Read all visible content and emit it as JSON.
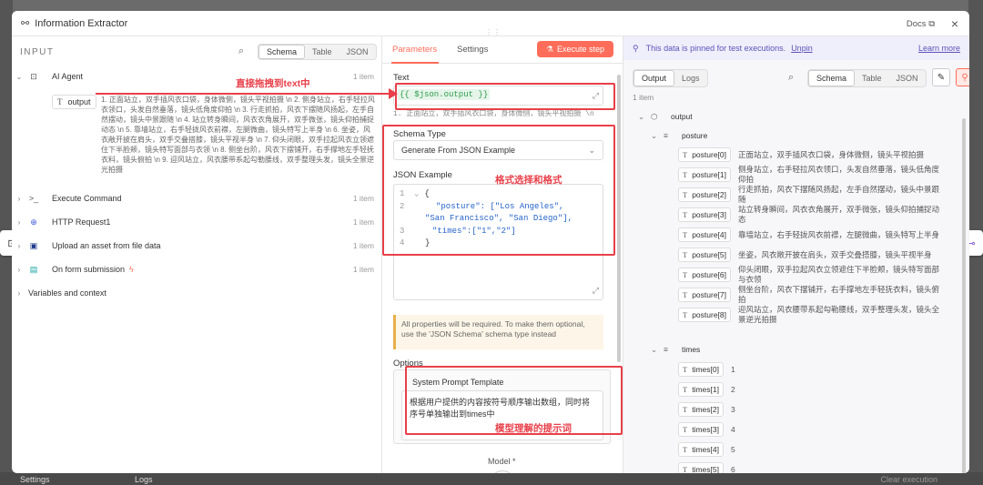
{
  "window": {
    "title": "Information Extractor",
    "docs_label": "Docs",
    "close_glyph": "×"
  },
  "background": {
    "settings_label": "Settings",
    "logs_label": "Logs",
    "last_exec_label": "Clear execution"
  },
  "input_panel": {
    "heading": "INPUT",
    "view_tabs": [
      "Schema",
      "Table",
      "JSON"
    ],
    "nodes": [
      {
        "name": "AI Agent",
        "count": "1 item",
        "icon": "robot-icon"
      },
      {
        "name": "Execute Command",
        "count": "1 item",
        "icon": "terminal-icon"
      },
      {
        "name": "HTTP Request1",
        "count": "1 item",
        "icon": "globe-icon"
      },
      {
        "name": "Upload an asset from file data",
        "count": "1 item",
        "icon": "image-icon"
      },
      {
        "name": "On form submission",
        "count": "1 item",
        "icon": "form-icon"
      }
    ],
    "variables_label": "Variables and context",
    "output_field_label": "output",
    "output_text": "1. 正面站立，双手插风衣口袋，身体微侧，镜头平视拍摄 \\n 2. 侧身站立，右手轻拉风衣领口，头发自然垂落，镜头低角度仰拍 \\n 3. 行走抓拍，风衣下摆随风扬起，左手自然摆动，镜头中景跟随 \\n 4. 站立转身瞬间，风衣衣角展开，双手微张，镜头仰拍捕捉动态 \\n 5. 靠墙站立，右手轻拢风衣前襟，左腿微曲，镜头特写上半身 \\n 6. 坐姿，风衣敞开披在肩头，双手交叠搭膝，镜头平视半身 \\n 7. 仰头闭眼，双手拉起风衣立领遮住下半脸颊，镜头特写面部与衣领 \\n 8. 侧坐台阶，风衣下摆铺开，右手撑地左手轻抚衣料，镜头俯拍 \\n 9. 迎风站立，风衣腰带系起勾勒腰线，双手整理头发，镜头全景逆光拍摄"
  },
  "annotations": {
    "drag_hint": "直接拖拽到text中",
    "format_hint": "格式选择和格式",
    "prompt_hint": "模型理解的提示词"
  },
  "params_panel": {
    "tabs": [
      "Parameters",
      "Settings"
    ],
    "execute_label": "Execute step",
    "text_label": "Text",
    "text_expression": "{{ $json.output }}",
    "text_preview": "1. 正面站立，双手插风衣口袋，身体微侧，镜头平视拍摄 \\n",
    "schema_type_label": "Schema Type",
    "schema_type_value": "Generate From JSON Example",
    "json_example_label": "JSON Example",
    "json_lines": [
      {
        "num": "1",
        "text": "{"
      },
      {
        "num": "2",
        "key": "\"posture\"",
        "text": ": [\"Los Angeles\",",
        "cont": "\"San Francisco\", \"San Diego\"],"
      },
      {
        "num": "3",
        "key": "\"times\"",
        "text": ":[\"1\",\"2\"]"
      },
      {
        "num": "4",
        "text": "}"
      }
    ],
    "note_text": "All properties will be required. To make them optional, use the 'JSON Schema' schema type instead",
    "options_label": "Options",
    "system_prompt_label": "System Prompt Template",
    "system_prompt_value": "根据用户提供的内容按符号顺序输出数组，同时将序号单独输出到times中",
    "model_label": "Model *"
  },
  "output_panel": {
    "pinned_text": "This data is pinned for test executions.",
    "unpin_label": "Unpin",
    "learn_more_label": "Learn more",
    "tabs": [
      "Output",
      "Logs"
    ],
    "view_tabs": [
      "Schema",
      "Table",
      "JSON"
    ],
    "item_count": "1 item",
    "root_label": "output",
    "posture_label": "posture",
    "posture_items": [
      {
        "key": "posture[0]",
        "value": "正面站立，双手插风衣口袋，身体微侧，镜头平视拍摄"
      },
      {
        "key": "posture[1]",
        "value": "侧身站立，右手轻拉风衣领口，头发自然垂落，镜头低角度仰拍"
      },
      {
        "key": "posture[2]",
        "value": "行走抓拍，风衣下摆随风扬起，左手自然摆动，镜头中景跟随"
      },
      {
        "key": "posture[3]",
        "value": "站立转身瞬间，风衣衣角展开，双手微张，镜头仰拍捕捉动态"
      },
      {
        "key": "posture[4]",
        "value": "靠墙站立，右手轻拢风衣前襟，左腿微曲，镜头特写上半身"
      },
      {
        "key": "posture[5]",
        "value": "坐姿，风衣敞开披在肩头，双手交叠搭膝，镜头平视半身"
      },
      {
        "key": "posture[6]",
        "value": "仰头闭眼，双手拉起风衣立领遮住下半脸颊，镜头特写面部与衣领"
      },
      {
        "key": "posture[7]",
        "value": "侧坐台阶，风衣下摆铺开，右手撑地左手轻抚衣料，镜头俯拍"
      },
      {
        "key": "posture[8]",
        "value": "迎风站立，风衣腰带系起勾勒腰线，双手整理头发，镜头全景逆光拍摄"
      }
    ],
    "times_label": "times",
    "times_items": [
      {
        "key": "times[0]",
        "value": "1"
      },
      {
        "key": "times[1]",
        "value": "2"
      },
      {
        "key": "times[2]",
        "value": "3"
      },
      {
        "key": "times[3]",
        "value": "4"
      },
      {
        "key": "times[4]",
        "value": "5"
      },
      {
        "key": "times[5]",
        "value": "6"
      }
    ]
  },
  "colors": {
    "accent": "#ff6d5a",
    "annotation": "#e8404a",
    "pinned": "#5a54b8"
  }
}
